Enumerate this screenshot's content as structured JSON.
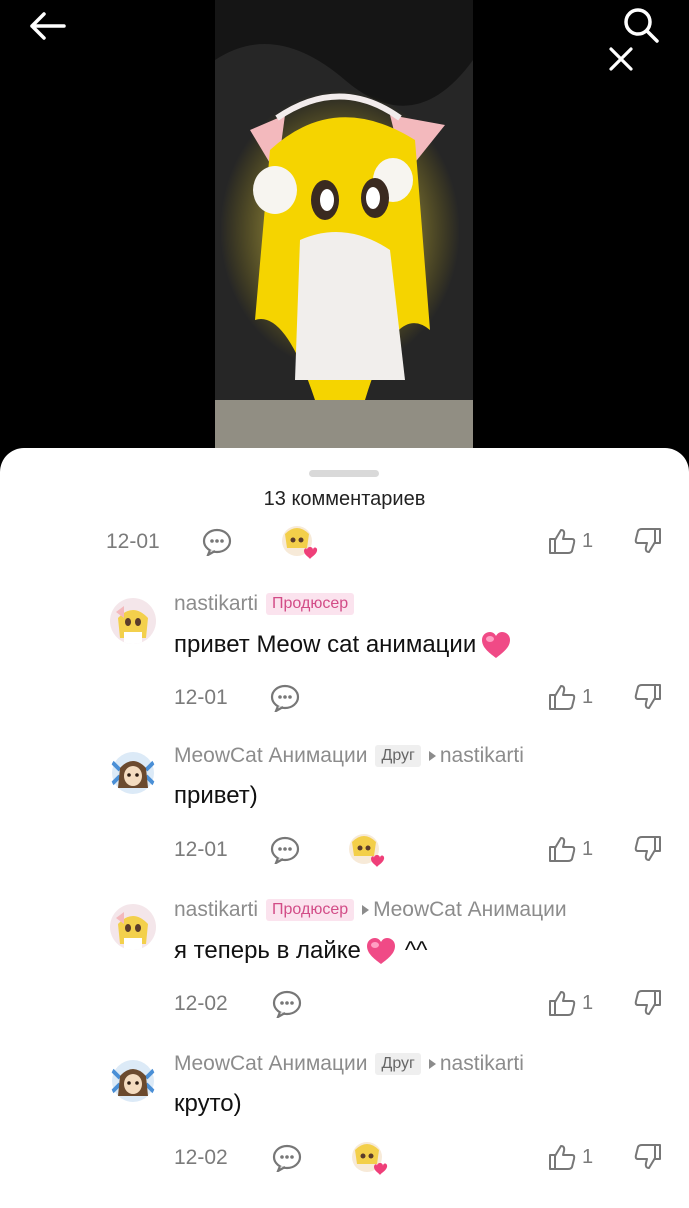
{
  "title": "13 комментариев",
  "icons": {
    "back": "arrow-left-icon",
    "search": "search-icon",
    "close": "close-icon"
  },
  "colors": {
    "badge_producer_bg": "#fbe3ee",
    "badge_producer_text": "#d24c87",
    "heart": "#ef3f79"
  },
  "top_meta": {
    "date": "12-01",
    "likes": "1"
  },
  "comments": [
    {
      "author": "nastikarti",
      "badge": "Продюсер",
      "reply_to": "",
      "text": "привет Meow cat анимации",
      "date": "12-01",
      "likes": "1"
    },
    {
      "author": "MeowCat Анимации",
      "badge": "Друг",
      "reply_to": "nastikarti",
      "text": "привет)",
      "date": "12-01",
      "likes": "1"
    },
    {
      "author": "nastikarti",
      "badge": "Продюсер",
      "reply_to": "MeowCat Анимации",
      "text": "я теперь в лайке",
      "text_suffix": "^^",
      "date": "12-02",
      "likes": "1"
    },
    {
      "author": "MeowCat Анимации",
      "badge": "Друг",
      "reply_to": "nastikarti",
      "text": "круто)",
      "date": "12-02",
      "likes": "1"
    }
  ]
}
